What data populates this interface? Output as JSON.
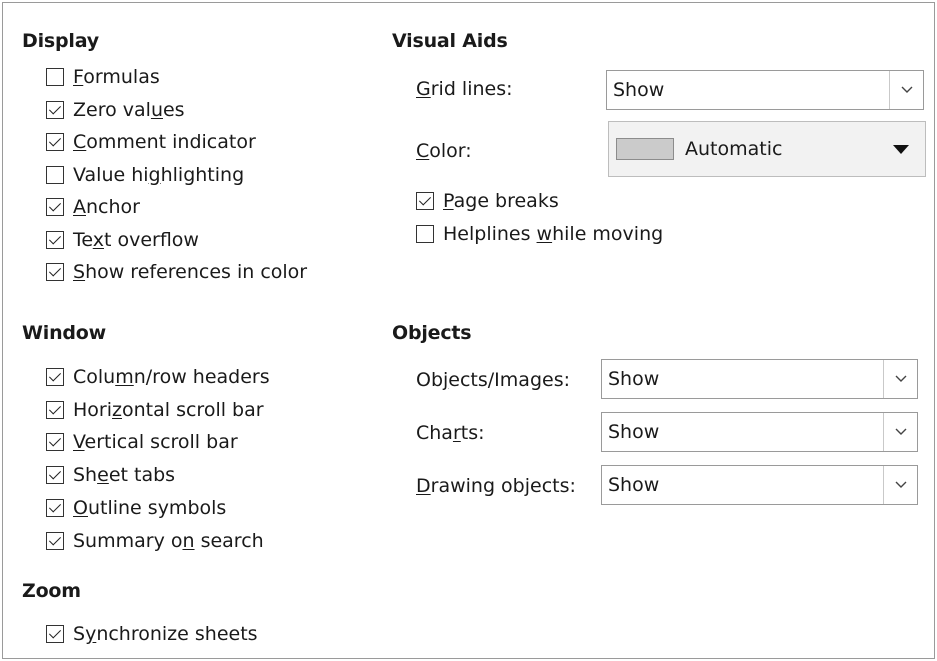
{
  "display": {
    "heading": "Display",
    "items": [
      {
        "pre": "",
        "u": "F",
        "post": "ormulas",
        "checked": false
      },
      {
        "pre": "Zero val",
        "u": "u",
        "post": "es",
        "checked": true
      },
      {
        "pre": "",
        "u": "C",
        "post": "omment indicator",
        "checked": true
      },
      {
        "pre": "Value hi",
        "u": "g",
        "post": "hlighting",
        "checked": false
      },
      {
        "pre": "",
        "u": "A",
        "post": "nchor",
        "checked": true
      },
      {
        "pre": "Te",
        "u": "x",
        "post": "t overflow",
        "checked": true
      },
      {
        "pre": "",
        "u": "S",
        "post": "how references in color",
        "checked": true
      }
    ]
  },
  "window": {
    "heading": "Window",
    "items": [
      {
        "pre": "Colu",
        "u": "m",
        "post": "n/row headers",
        "checked": true
      },
      {
        "pre": "Hori",
        "u": "z",
        "post": "ontal scroll bar",
        "checked": true
      },
      {
        "pre": "",
        "u": "V",
        "post": "ertical scroll bar",
        "checked": true
      },
      {
        "pre": "Sh",
        "u": "e",
        "post": "et tabs",
        "checked": true
      },
      {
        "pre": "",
        "u": "O",
        "post": "utline symbols",
        "checked": true
      },
      {
        "pre": "Summary o",
        "u": "n",
        "post": " search",
        "checked": true
      }
    ]
  },
  "zoom": {
    "heading": "Zoom",
    "items": [
      {
        "pre": "S",
        "u": "y",
        "post": "nchronize sheets",
        "checked": true
      }
    ]
  },
  "visual_aids": {
    "heading": "Visual Aids",
    "grid_lines": {
      "pre": "",
      "u": "G",
      "post": "rid lines:",
      "value": "Show"
    },
    "color": {
      "pre": "",
      "u": "C",
      "post": "olor:",
      "value": "Automatic",
      "swatch": "#cbcbcb"
    },
    "items": [
      {
        "pre": "",
        "u": "P",
        "post": "age breaks",
        "checked": true
      },
      {
        "pre": "Helplines ",
        "u": "w",
        "post": "hile moving",
        "checked": false
      }
    ]
  },
  "objects": {
    "heading": "Objects",
    "rows": [
      {
        "pre": "Ob",
        "u": "j",
        "post": "ects/Images:",
        "value": "Show"
      },
      {
        "pre": "Cha",
        "u": "r",
        "post": "ts:",
        "value": "Show"
      },
      {
        "pre": "",
        "u": "D",
        "post": "rawing objects:",
        "value": "Show"
      }
    ]
  }
}
